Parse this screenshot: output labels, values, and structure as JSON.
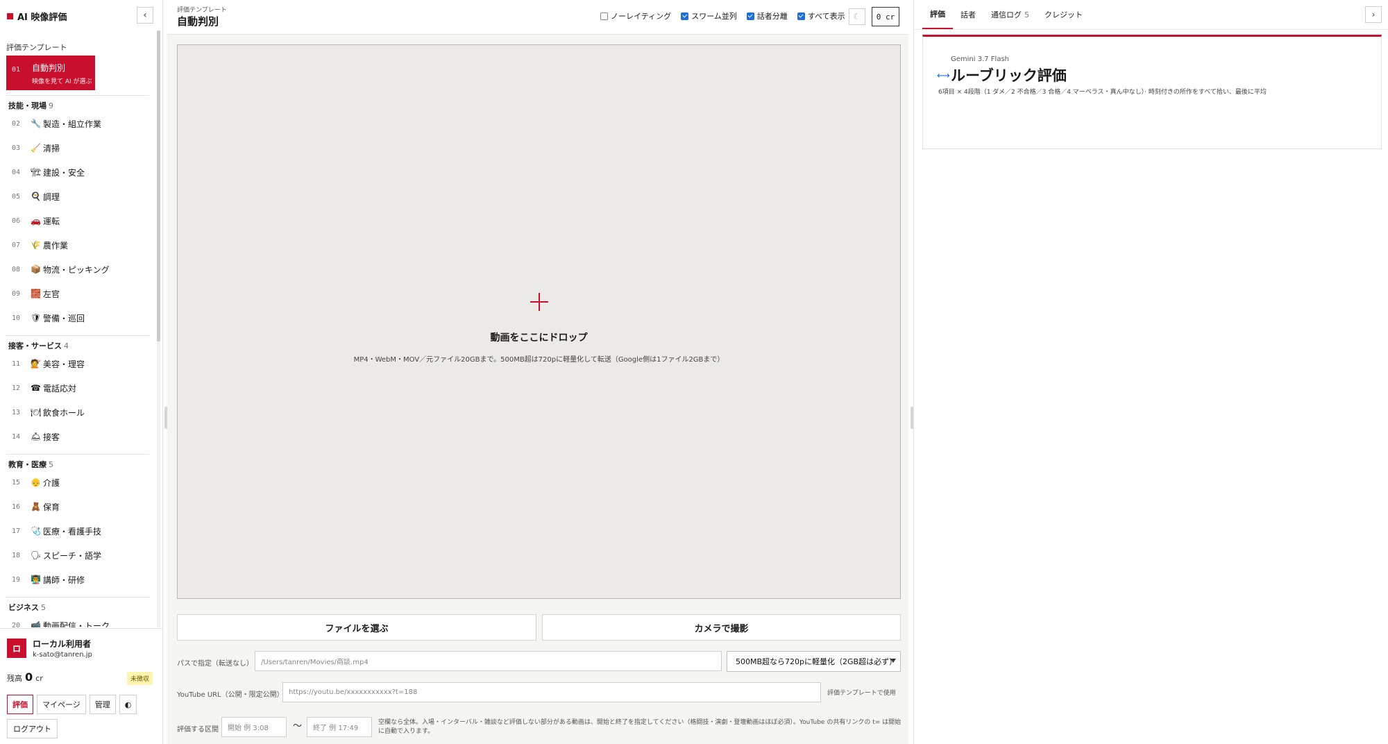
{
  "app": {
    "title": "AI 映像評価",
    "collapse": "‹"
  },
  "sidebar": {
    "section_title": "評価テンプレート",
    "active": {
      "num": "01",
      "name": "自動判別",
      "sub": "映像を見て AI が選ぶ"
    },
    "categories": [
      {
        "name": "技能・現場",
        "count": "9",
        "items": [
          {
            "n": "02",
            "icon": "🔧",
            "label": "製造・組立作業"
          },
          {
            "n": "03",
            "icon": "🧹",
            "label": "清掃"
          },
          {
            "n": "04",
            "icon": "🏗",
            "label": "建設・安全"
          },
          {
            "n": "05",
            "icon": "🍳",
            "label": "調理"
          },
          {
            "n": "06",
            "icon": "🚗",
            "label": "運転"
          },
          {
            "n": "07",
            "icon": "🌾",
            "label": "農作業"
          },
          {
            "n": "08",
            "icon": "📦",
            "label": "物流・ピッキング"
          },
          {
            "n": "09",
            "icon": "🧱",
            "label": "左官"
          },
          {
            "n": "10",
            "icon": "🛡",
            "label": "警備・巡回"
          }
        ]
      },
      {
        "name": "接客・サービス",
        "count": "4",
        "items": [
          {
            "n": "11",
            "icon": "💇",
            "label": "美容・理容"
          },
          {
            "n": "12",
            "icon": "☎",
            "label": "電話応対"
          },
          {
            "n": "13",
            "icon": "🍽",
            "label": "飲食ホール"
          },
          {
            "n": "14",
            "icon": "🛎",
            "label": "接客"
          }
        ]
      },
      {
        "name": "教育・医療",
        "count": "5",
        "items": [
          {
            "n": "15",
            "icon": "👴",
            "label": "介護"
          },
          {
            "n": "16",
            "icon": "🧸",
            "label": "保育"
          },
          {
            "n": "17",
            "icon": "🩺",
            "label": "医療・看護手技"
          },
          {
            "n": "18",
            "icon": "🗣",
            "label": "スピーチ・語学"
          },
          {
            "n": "19",
            "icon": "👨‍🏫",
            "label": "講師・研修"
          }
        ]
      },
      {
        "name": "ビジネス",
        "count": "5",
        "items": [
          {
            "n": "20",
            "icon": "📹",
            "label": "動画配信・トーク"
          }
        ]
      }
    ]
  },
  "user": {
    "avatar": "ロ",
    "name": "ローカル利用者",
    "email": "k-sato@tanren.jp",
    "balance_label": "残高",
    "balance": "0",
    "balance_unit": "cr",
    "unpaid": "未徴収",
    "buttons": [
      "評価",
      "マイページ",
      "管理",
      "◐"
    ],
    "logout": "ログアウト"
  },
  "center": {
    "tpl_label": "評価テンプレート",
    "tpl_name": "自動判別",
    "options": [
      {
        "label": "ノーレイティング",
        "checked": false
      },
      {
        "label": "スワーム並列",
        "checked": true
      },
      {
        "label": "話者分離",
        "checked": true
      },
      {
        "label": "すべて表示",
        "checked": true
      }
    ],
    "theme_icon": "☾",
    "credits": "0 cr",
    "drop_title": "動画をここにドロップ",
    "drop_sub": "MP4・WebM・MOV／元ファイル20GBまで。500MB超は720pに軽量化して転送（Google側は1ファイル2GBまで）",
    "choose_file": "ファイルを選ぶ",
    "camera": "カメラで撮影",
    "path_label": "パスで指定（転送なし）",
    "path_placeholder": "/Users/tanren/Movies/商談.mp4",
    "compress_select": "500MB超なら720pに軽量化（2GB超は必ず）",
    "yt_label": "YouTube URL（公開・限定公開）",
    "yt_placeholder": "https://youtu.be/xxxxxxxxxxx?t=188",
    "yt_note": "評価テンプレートで使用",
    "range_label": "評価する区間",
    "start_placeholder": "開始 例 3:08",
    "tilde": "〜",
    "end_placeholder": "終了 例 17:49",
    "range_note": "空欄なら全体。入場・インターバル・雑談など評価しない部分がある動画は、開始と終了を指定してください（格闘技・演劇・登壇動画はほぼ必須）。YouTube の共有リンクの t= は開始に自動で入ります。"
  },
  "right": {
    "tabs": [
      {
        "label": "評価",
        "count": ""
      },
      {
        "label": "話者",
        "count": ""
      },
      {
        "label": "通信ログ",
        "count": "5"
      },
      {
        "label": "クレジット",
        "count": ""
      }
    ],
    "arrow": "›",
    "model": "Gemini 3.7 Flash",
    "title": "ルーブリック評価",
    "desc": "6項目 × 4段階（1 ダメ／2 不合格／3 合格／4 マーベラス・真ん中なし）· 時刻付きの所作をすべて拾い、最後に平均",
    "icon": "⟷"
  }
}
